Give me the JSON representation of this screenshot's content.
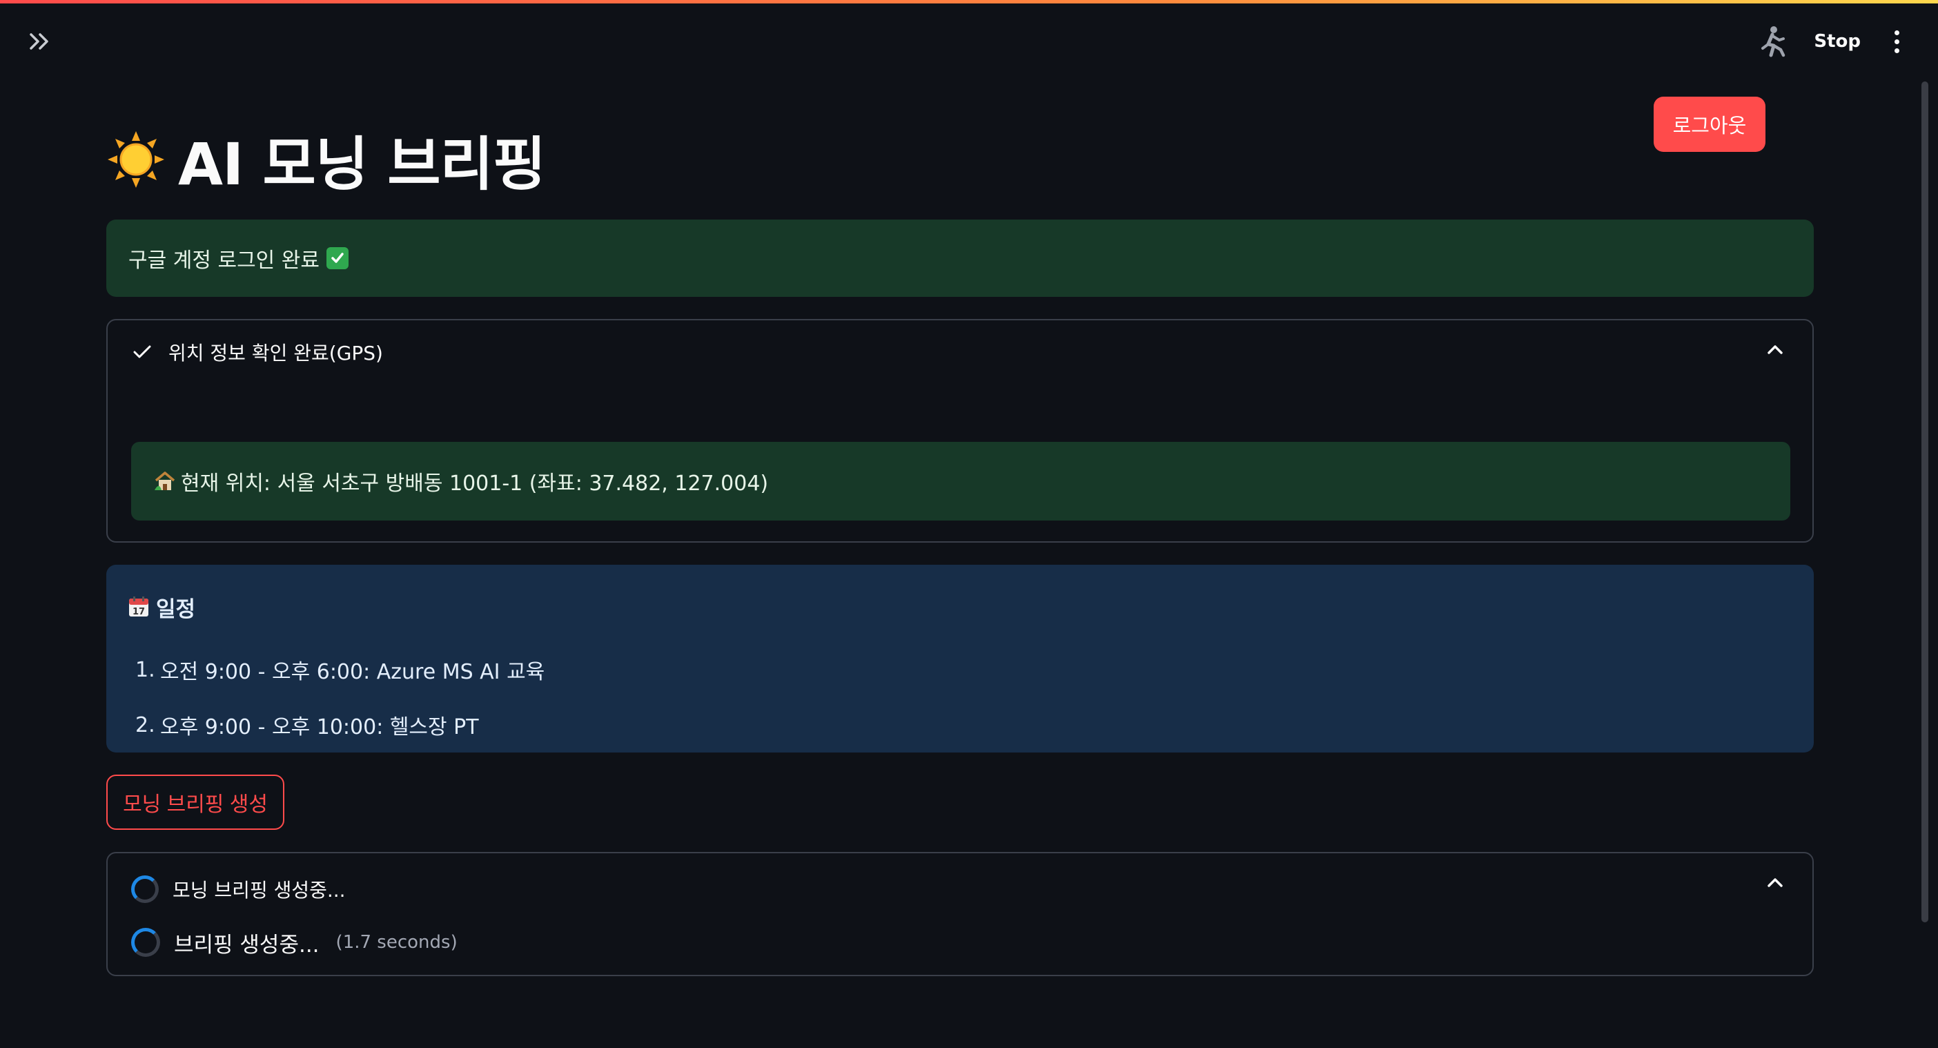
{
  "app": {
    "title": "AI 모닝 브리핑",
    "title_icon": "sun-icon"
  },
  "toolbar": {
    "stop_label": "Stop",
    "running_icon": "running-man-icon",
    "menu_icon": "kebab-menu-icon"
  },
  "sidebar": {
    "expand_icon": "double-chevron-right-icon"
  },
  "logout": {
    "label": "로그아웃"
  },
  "login_status": {
    "text": "구글 계정 로그인 완료",
    "icon": "check-box-icon"
  },
  "gps": {
    "header_label": "위치 정보 확인 완료(GPS)",
    "location_text": "현재 위치: 서울 서초구 방배동 1001-1 (좌표: 37.482, 127.004)",
    "location_icon": "house-icon"
  },
  "schedule": {
    "title": "일정",
    "title_icon": "calendar-icon",
    "items": [
      {
        "num": "1.",
        "text": "오전 9:00 - 오후 6:00: Azure MS AI 교육"
      },
      {
        "num": "2.",
        "text": "오후 9:00 - 오후 10:00: 헬스장 PT"
      }
    ]
  },
  "generate": {
    "button_label": "모닝 브리핑 생성"
  },
  "status": {
    "header_label": "모닝 브리핑 생성중...",
    "task_label": "브리핑 생성중...",
    "elapsed": "(1.7 seconds)"
  },
  "colors": {
    "background": "#0e1117",
    "primary": "#ff4b4b",
    "success_bg": "#173928",
    "info_bg": "#172d48",
    "spinner": "#1e88e5"
  }
}
